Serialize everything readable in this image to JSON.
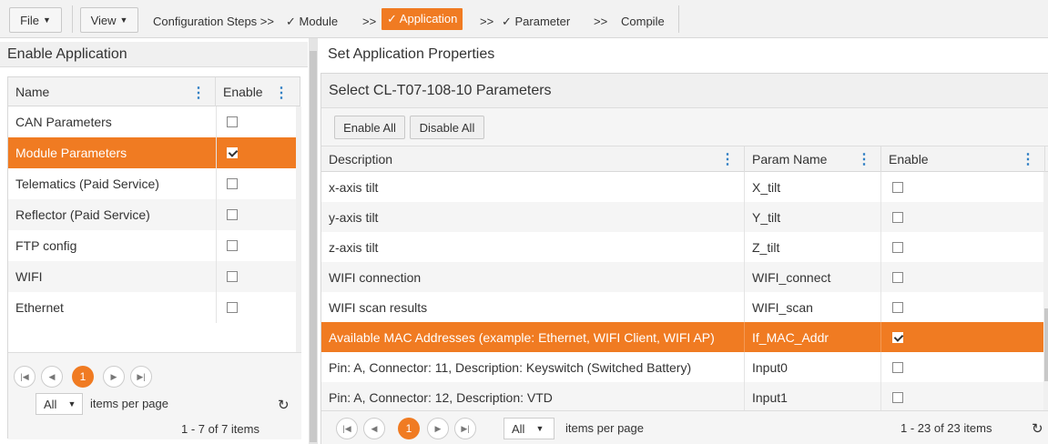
{
  "toolbar": {
    "file_label": "File",
    "view_label": "View",
    "steps_prefix": "Configuration Steps >>",
    "step_module": "✓ Module",
    "sep1": ">>",
    "step_application": "✓ Application",
    "sep2": ">>",
    "step_parameter": "✓ Parameter",
    "sep3": ">>",
    "step_compile": "Compile",
    "accent": "#f07b22"
  },
  "left": {
    "title": "Enable Application",
    "columns": [
      "Name",
      "Enable"
    ],
    "rows": [
      {
        "name": "CAN Parameters",
        "enabled": false
      },
      {
        "name": "Module Parameters",
        "enabled": true,
        "selected": true
      },
      {
        "name": "Telematics (Paid Service)",
        "enabled": false
      },
      {
        "name": "Reflector (Paid Service)",
        "enabled": false
      },
      {
        "name": "FTP config",
        "enabled": false
      },
      {
        "name": "WIFI",
        "enabled": false
      },
      {
        "name": "Ethernet",
        "enabled": false
      }
    ],
    "pager": {
      "page": "1",
      "size": "All",
      "per_page_label": "items per page",
      "summary": "1 - 7 of 7 items"
    }
  },
  "right": {
    "title": "Set Application Properties",
    "subtitle": "Select CL-T07-108-10 Parameters",
    "enable_all": "Enable All",
    "disable_all": "Disable All",
    "columns": [
      "Description",
      "Param Name",
      "Enable"
    ],
    "rows": [
      {
        "desc": "x-axis tilt",
        "param": "X_tilt",
        "enabled": false
      },
      {
        "desc": "y-axis tilt",
        "param": "Y_tilt",
        "enabled": false
      },
      {
        "desc": "z-axis tilt",
        "param": "Z_tilt",
        "enabled": false
      },
      {
        "desc": "WIFI connection",
        "param": "WIFI_connect",
        "enabled": false
      },
      {
        "desc": "WIFI scan results",
        "param": "WIFI_scan",
        "enabled": false
      },
      {
        "desc": "Available MAC Addresses (example: Ethernet, WIFI Client, WIFI AP)",
        "param": "If_MAC_Addr",
        "enabled": true,
        "selected": true
      },
      {
        "desc": "Pin: A, Connector: 11, Description: Keyswitch (Switched Battery)",
        "param": "Input0",
        "enabled": false
      },
      {
        "desc": "Pin: A, Connector: 12, Description: VTD",
        "param": "Input1",
        "enabled": false
      }
    ],
    "pager": {
      "page": "1",
      "size": "All",
      "per_page_label": "items per page",
      "summary": "1 - 23 of 23 items"
    }
  }
}
